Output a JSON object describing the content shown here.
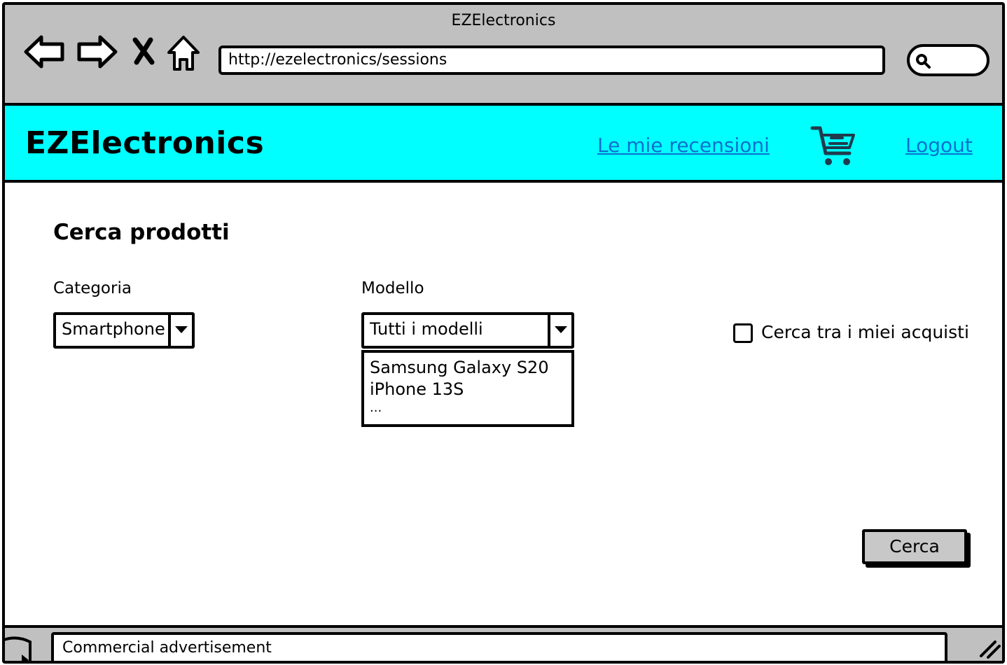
{
  "browser": {
    "window_title": "EZElectronics",
    "url": "http://ezelectronics/sessions"
  },
  "header": {
    "brand": "EZElectronics",
    "reviews_link": "Le mie recensioni",
    "logout_link": "Logout",
    "background_color": "#00ffff",
    "link_color": "#0d6fcf"
  },
  "search": {
    "title": "Cerca prodotti",
    "category_label": "Categoria",
    "category_value": "Smartphone",
    "model_label": "Modello",
    "model_value": "Tutti i modelli",
    "model_options": [
      "Samsung Galaxy S20",
      "iPhone 13S",
      "..."
    ],
    "purchases_checkbox_label": "Cerca tra i miei acquisti",
    "purchases_checked": false,
    "submit_label": "Cerca"
  },
  "footer": {
    "ad_text": "Commercial advertisement"
  },
  "icons": {
    "back": "arrow-left-icon",
    "forward": "arrow-right-icon",
    "stop": "close-icon",
    "home": "home-icon",
    "browser_search": "search-icon",
    "cart": "cart-icon"
  }
}
